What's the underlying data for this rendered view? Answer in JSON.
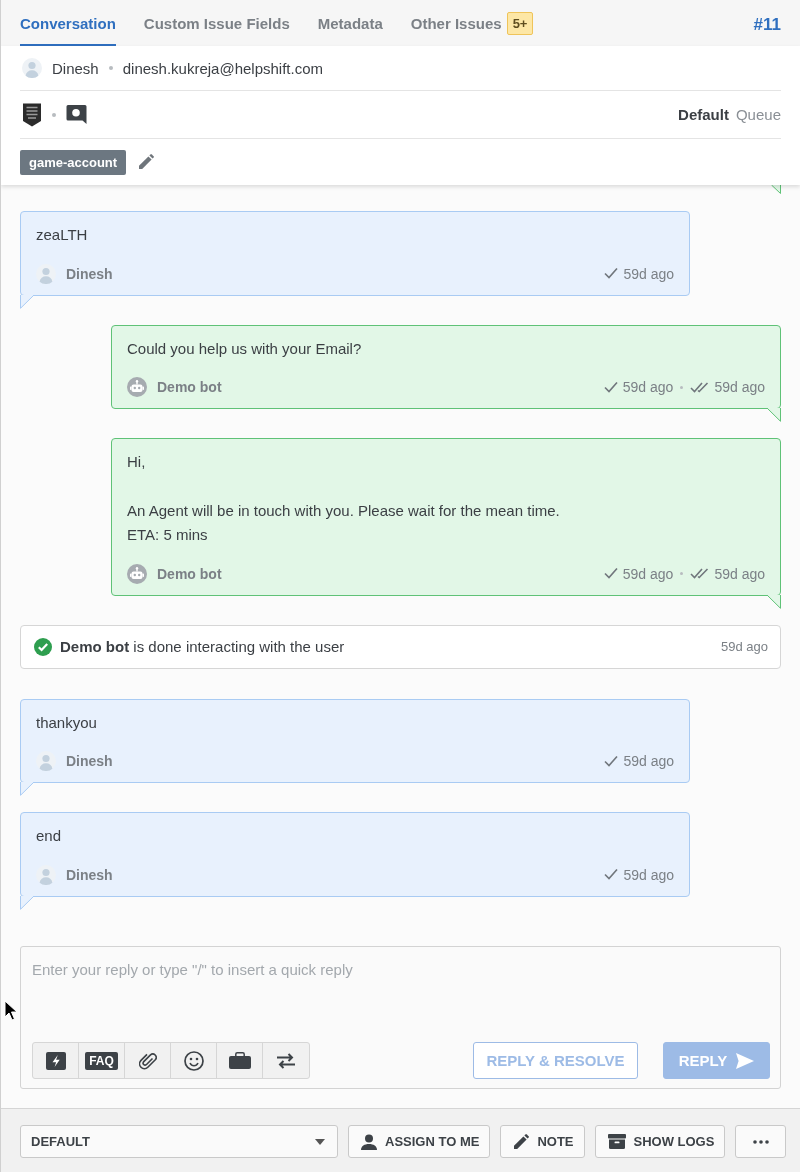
{
  "tabs": [
    {
      "label": "Conversation",
      "selected": true
    },
    {
      "label": "Custom Issue Fields",
      "selected": false
    },
    {
      "label": "Metadata",
      "selected": false
    },
    {
      "label": "Other Issues",
      "selected": false,
      "badge": "5+"
    }
  ],
  "issue_number": "#11",
  "customer": {
    "name": "Dinesh",
    "email": "dinesh.kukreja@helpshift.com"
  },
  "source": {
    "queue": "Default",
    "queue_label": "Queue"
  },
  "tags": [
    {
      "label": "game-account"
    }
  ],
  "messages": [
    {
      "kind": "user",
      "author": "Dinesh",
      "paragraphs": [
        [
          "zeaLTH"
        ]
      ],
      "receipts": [
        {
          "kind": "delivered",
          "time": "59d ago"
        }
      ]
    },
    {
      "kind": "bot",
      "author": "Demo bot",
      "paragraphs": [
        [
          "Could you help us with your Email?"
        ]
      ],
      "receipts": [
        {
          "kind": "delivered",
          "time": "59d ago"
        },
        {
          "kind": "read",
          "time": "59d ago"
        }
      ]
    },
    {
      "kind": "bot",
      "author": "Demo bot",
      "paragraphs": [
        [
          "Hi,"
        ],
        [
          "An Agent will be in touch with you. Please wait for the mean time.",
          "ETA: 5 mins"
        ]
      ],
      "receipts": [
        {
          "kind": "delivered",
          "time": "59d ago"
        },
        {
          "kind": "read",
          "time": "59d ago"
        }
      ]
    },
    {
      "kind": "event",
      "text": "**Demo bot** is done interacting with the user",
      "time": "59d ago"
    },
    {
      "kind": "user",
      "author": "Dinesh",
      "paragraphs": [
        [
          "thankyou"
        ]
      ],
      "receipts": [
        {
          "kind": "delivered",
          "time": "59d ago"
        }
      ]
    },
    {
      "kind": "user",
      "author": "Dinesh",
      "paragraphs": [
        [
          "end"
        ]
      ],
      "receipts": [
        {
          "kind": "delivered",
          "time": "59d ago"
        }
      ]
    }
  ],
  "composer": {
    "placeholder": "Enter your reply or type \"/\" to insert a quick reply",
    "tools": [
      {
        "kind": "quick-reply"
      },
      {
        "kind": "faq",
        "label": "FAQ"
      },
      {
        "kind": "attach"
      },
      {
        "kind": "emoji"
      },
      {
        "kind": "briefcase"
      },
      {
        "kind": "swap"
      }
    ],
    "actions": [
      {
        "kind": "outline",
        "label": "REPLY & RESOLVE",
        "disabled": true
      },
      {
        "kind": "primary",
        "label": "REPLY",
        "disabled": true
      }
    ]
  },
  "footer": {
    "dropdown": {
      "value": "DEFAULT"
    },
    "buttons": [
      {
        "kind": "assign",
        "label": "ASSIGN TO ME"
      },
      {
        "kind": "note",
        "label": "NOTE"
      },
      {
        "kind": "logs",
        "label": "SHOW LOGS"
      },
      {
        "kind": "more"
      }
    ]
  }
}
